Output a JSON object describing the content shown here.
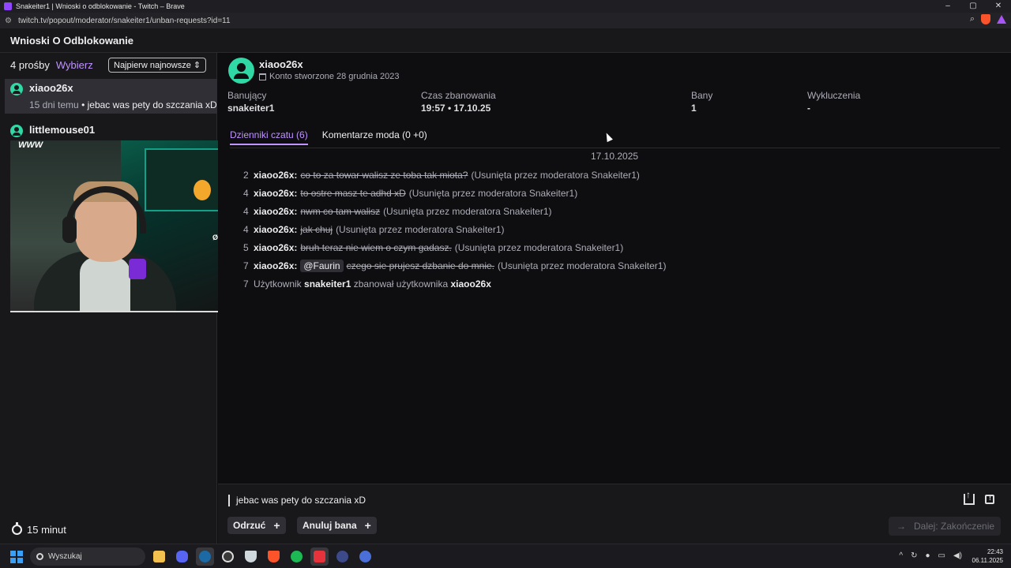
{
  "browser": {
    "window_title": "Snakeiter1 | Wnioski o odblokowanie - Twitch – Brave",
    "url": "twitch.tv/popout/moderator/snakeiter1/unban-requests?id=11"
  },
  "header": {
    "title": "Wnioski O Odblokowanie"
  },
  "left": {
    "count": "4 prośby",
    "select": "Wybierz",
    "sort": "Najpierw najnowsze",
    "requests": [
      {
        "user": "xiaoo26x",
        "age": "15 dni temu",
        "bullet": "•",
        "preview": "jebac was pety do szczania xD"
      },
      {
        "user": "littlemouse01"
      }
    ],
    "stream_logo": "WWW",
    "stream_brand": "ØDE",
    "timer": "15 minut"
  },
  "main": {
    "user": "xiaoo26x",
    "created": "Konto stworzone 28 grudnia 2023",
    "stats": [
      {
        "label": "Banujący",
        "value": "snakeiter1"
      },
      {
        "label": "Czas zbanowania",
        "value": "19:57 • 17.10.25"
      },
      {
        "label": "Bany",
        "value": "1"
      },
      {
        "label": "Wykluczenia",
        "value": "-"
      }
    ],
    "tabs": [
      "Dzienniki czatu (6)",
      "Komentarze moda (0 +0)"
    ],
    "date": "17.10.2025",
    "logs": [
      {
        "ts": "2",
        "user": "xiaoo26x",
        "sep": ":",
        "msg": "co to za towar walisz ze toba tak miota?",
        "note": "(Usunięta przez moderatora Snakeiter1)"
      },
      {
        "ts": "4",
        "user": "xiaoo26x",
        "sep": ":",
        "msg": "to ostre masz te adhd xD",
        "note": "(Usunięta przez moderatora Snakeiter1)"
      },
      {
        "ts": "4",
        "user": "xiaoo26x",
        "sep": ":",
        "msg": "nwm co tam walisz",
        "note": "(Usunięta przez moderatora Snakeiter1)"
      },
      {
        "ts": "4",
        "user": "xiaoo26x",
        "sep": ":",
        "msg": "jak chuj",
        "note": "(Usunięta przez moderatora Snakeiter1)"
      },
      {
        "ts": "5",
        "user": "xiaoo26x",
        "sep": ":",
        "msg": "bruh teraz nie wiem o czym gadasz.",
        "note": "(Usunięta przez moderatora Snakeiter1)"
      },
      {
        "ts": "7",
        "user": "xiaoo26x",
        "sep": ":",
        "mention": "@Faurin",
        "msg": "czego sie prujesz dzbanie do mnie.",
        "note": "(Usunięta przez moderatora Snakeiter1)"
      }
    ],
    "ban_log": {
      "ts": "7",
      "prefix": "Użytkownik",
      "mod": "snakeiter1",
      "middle": "zbanował użytkownika",
      "target": "xiaoo26x"
    }
  },
  "bottom": {
    "request_message": "jebac was pety do szczania xD",
    "reject": "Odrzuć",
    "plus": "+",
    "unban": "Anuluj bana",
    "next": "Dalej: Zakończenie",
    "next_arrow": "→"
  },
  "taskbar": {
    "search": "Wyszukaj",
    "time": "22:43",
    "date": "06.11.2025",
    "tray_arrow": "^"
  },
  "window_controls": {
    "minimize": "–",
    "maximize": "▢",
    "close": "✕"
  },
  "colors": {
    "accent": "#bf94ff",
    "avatar": "#2fd8a4",
    "bg": "#0e0e10"
  }
}
